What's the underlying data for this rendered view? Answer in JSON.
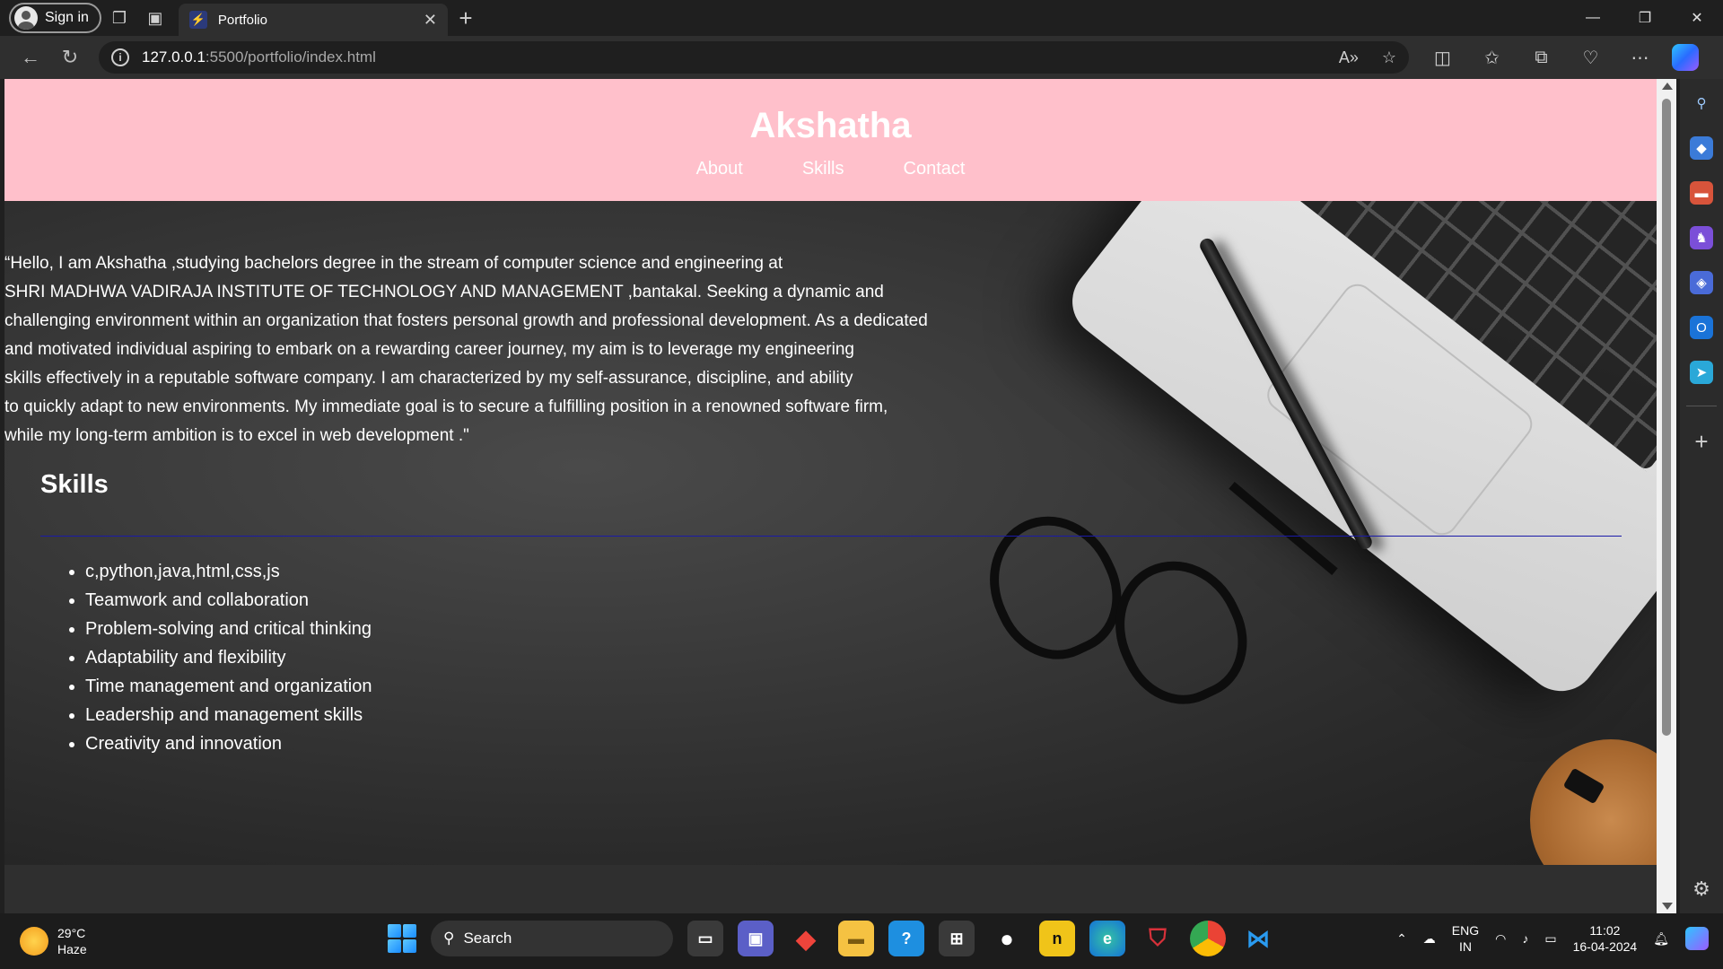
{
  "browser": {
    "signin_label": "Sign in",
    "tab_title": "Portfolio",
    "url_host": "127.0.0.1",
    "url_path": ":5500/portfolio/index.html"
  },
  "page": {
    "site_title": "Akshatha",
    "nav": [
      "About",
      "Skills",
      "Contact"
    ],
    "intro_lines": [
      "“Hello, I am Akshatha ,studying bachelors degree in the stream of computer science and engineering at",
      "SHRI MADHWA VADIRAJA INSTITUTE OF TECHNOLOGY AND MANAGEMENT ,bantakal. Seeking a dynamic and",
      "challenging environment within an organization that fosters personal growth and professional development. As a dedicated",
      "and motivated individual aspiring to embark on a rewarding career journey, my aim is to leverage my engineering",
      "skills effectively in a reputable software company. I am characterized by my self-assurance, discipline, and ability",
      "to quickly adapt to new environments. My immediate goal is to secure a fulfilling position in a renowned software firm,",
      "while my long-term ambition is to excel in web development .\""
    ],
    "skills_title": "Skills",
    "skills": [
      "c,python,java,html,css,js",
      "Teamwork and collaboration",
      "Problem-solving and critical thinking",
      "Adaptability and flexibility",
      "Time management and organization",
      "Leadership and management skills",
      "Creativity and innovation"
    ],
    "colors": {
      "header_bg": "#ffc0cb",
      "rule": "#1a1aa8"
    }
  },
  "taskbar": {
    "temperature": "29°C",
    "weather": "Haze",
    "search_label": "Search",
    "lang_top": "ENG",
    "lang_bottom": "IN",
    "time": "11:02",
    "date": "16-04-2024"
  }
}
